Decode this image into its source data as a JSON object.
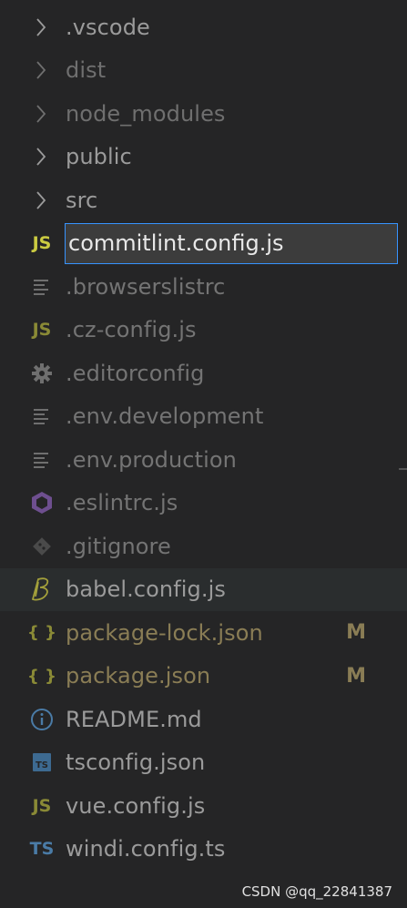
{
  "explorer": {
    "folders": [
      {
        "label": ".vscode",
        "color": "#9b9b9b"
      },
      {
        "label": "dist",
        "color": "#6f6f6f"
      },
      {
        "label": "node_modules",
        "color": "#6f6f6f"
      },
      {
        "label": "public",
        "color": "#9b9b9b"
      },
      {
        "label": "src",
        "color": "#9b9b9b"
      }
    ],
    "rename": {
      "value": "commitlint.config.js",
      "icon_text": "JS"
    },
    "files": [
      {
        "label": ".browserslistrc",
        "color": "#747474",
        "icon": "lines-icon"
      },
      {
        "label": ".cz-config.js",
        "color": "#747474",
        "icon_text": "JS"
      },
      {
        "label": ".editorconfig",
        "color": "#747474",
        "icon": "gear-icon"
      },
      {
        "label": ".env.development",
        "color": "#747474",
        "icon": "lines-icon"
      },
      {
        "label": ".env.production",
        "color": "#747474",
        "icon": "lines-icon"
      },
      {
        "label": ".eslintrc.js",
        "color": "#747474",
        "icon": "eslint-icon"
      },
      {
        "label": ".gitignore",
        "color": "#747474",
        "icon": "git-icon"
      },
      {
        "label": "babel.config.js",
        "color": "#9b9b9b",
        "icon": "babel-icon"
      },
      {
        "label": "package-lock.json",
        "color": "#8a7d55",
        "icon_text": "{ }",
        "status": "M"
      },
      {
        "label": "package.json",
        "color": "#8a7d55",
        "icon_text": "{ }",
        "status": "M"
      },
      {
        "label": "README.md",
        "color": "#9b9b9b",
        "icon": "info-icon"
      },
      {
        "label": "tsconfig.json",
        "color": "#9b9b9b",
        "icon_text": "TS"
      },
      {
        "label": "vue.config.js",
        "color": "#9b9b9b",
        "icon_text": "JS"
      },
      {
        "label": "windi.config.ts",
        "color": "#9b9b9b",
        "icon_text": "TS"
      }
    ]
  },
  "watermark": "CSDN @qq_22841387",
  "colors": {
    "js_icon": "#cbcb41",
    "js_icon_dim": "#8a8a36",
    "json_icon": "#8a8a36",
    "ts_icon": "#4a7ba6",
    "eslint_icon": "#6e4f8f",
    "babel_icon": "#a3a03b",
    "modified": "#8a7d55",
    "focus_border": "#3794ff"
  }
}
